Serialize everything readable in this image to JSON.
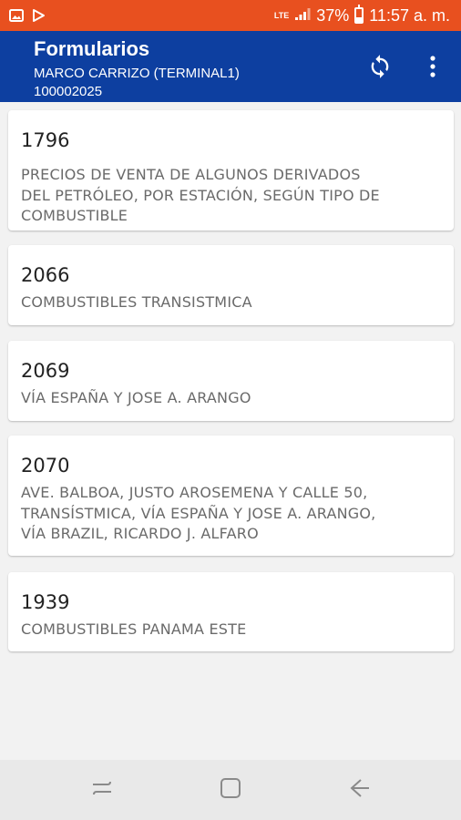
{
  "status_bar": {
    "battery": "37%",
    "time": "11:57 a. m.",
    "network": "LTE",
    "battery_level": 0.37,
    "icons": [
      "gallery-icon",
      "play-store-icon",
      "lte-icon",
      "signal-icon",
      "battery-icon"
    ]
  },
  "app_bar": {
    "title": "Formularios",
    "subtitle_user": "MARCO CARRIZO (TERMINAL1)",
    "subtitle_id": "100002025",
    "actions": [
      "sync-icon",
      "more-vert-icon"
    ]
  },
  "forms": [
    {
      "code": "1796",
      "description": "PRECIOS DE VENTA DE ALGUNOS DERIVADOS DEL PETRÓLEO, POR ESTACIÓN, SEGÚN TIPO DE COMBUSTIBLE",
      "lines": [
        "PRECIOS DE VENTA DE ALGUNOS DERIVADOS",
        "DEL PETRÓLEO, POR ESTACIÓN, SEGÚN TIPO DE",
        "COMBUSTIBLE"
      ]
    },
    {
      "code": "2066",
      "description": "COMBUSTIBLES TRANSISTMICA",
      "lines": [
        "COMBUSTIBLES TRANSISTMICA"
      ]
    },
    {
      "code": "2069",
      "description": "VÍA ESPAÑA Y JOSE A. ARANGO",
      "lines": [
        "VÍA ESPAÑA Y JOSE A. ARANGO"
      ]
    },
    {
      "code": "2070",
      "description": "AVE. BALBOA, JUSTO AROSEMENA Y CALLE 50, TRANSÍSTMICA, VÍA ESPAÑA Y JOSE A. ARANGO, VÍA BRAZIL, RICARDO J. ALFARO",
      "lines": [
        "AVE. BALBOA, JUSTO AROSEMENA Y CALLE 50,",
        "TRANSÍSTMICA, VÍA ESPAÑA Y JOSE A. ARANGO,",
        "VÍA BRAZIL, RICARDO J. ALFARO"
      ]
    },
    {
      "code": "1939",
      "description": "COMBUSTIBLES PANAMA ESTE",
      "lines": [
        "COMBUSTIBLES PANAMA ESTE"
      ]
    }
  ],
  "colors": {
    "status_bar": "#e8501f",
    "app_bar": "#0d3fa0",
    "background": "#f2f2f2",
    "card": "#ffffff",
    "nav_bar": "#e9e9e9"
  },
  "nav_bar": {
    "buttons": [
      "recent-apps-icon",
      "home-icon",
      "back-icon"
    ]
  }
}
